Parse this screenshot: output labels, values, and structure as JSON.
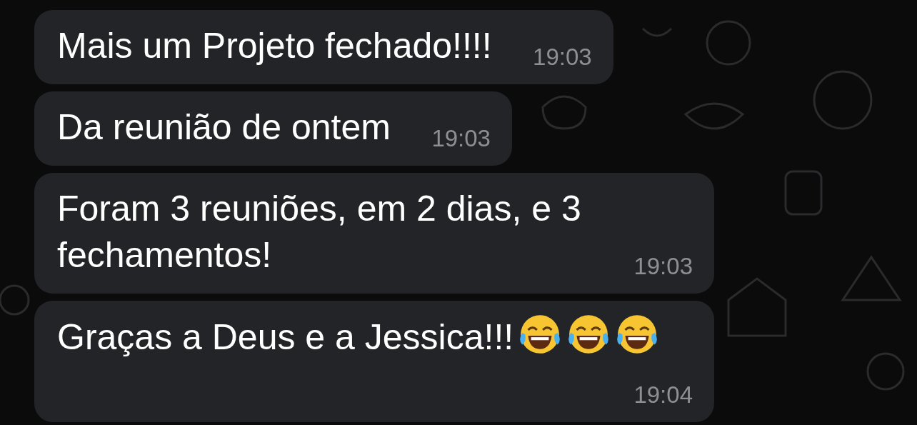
{
  "messages": [
    {
      "text": "Mais um Projeto fechado!!!!",
      "time": "19:03"
    },
    {
      "text": "Da reunião de ontem",
      "time": "19:03"
    },
    {
      "text": "Foram 3 reuniões, em 2 dias, e 3 fechamentos!",
      "time": "19:03"
    },
    {
      "text": "Graças a Deus e a Jessica!!!",
      "time": "19:04",
      "emojis": [
        {
          "kind": "laughing-tears"
        },
        {
          "kind": "laughing-tears"
        },
        {
          "kind": "laughing-tears"
        }
      ]
    }
  ]
}
